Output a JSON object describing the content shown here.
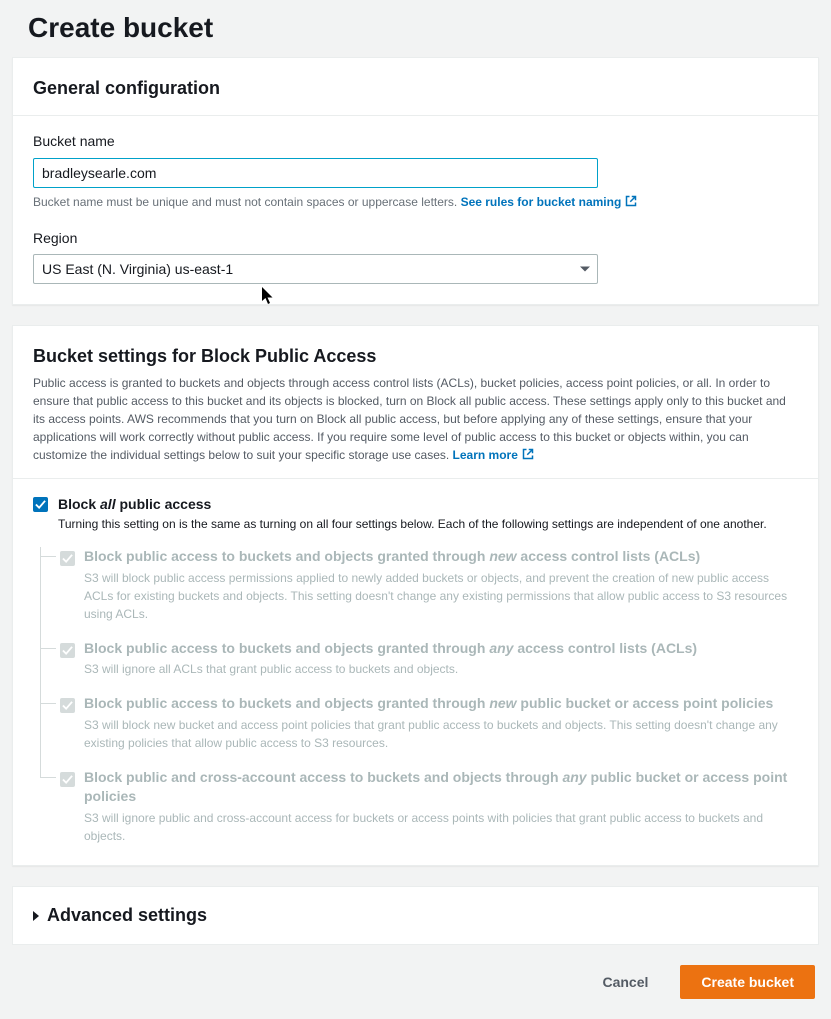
{
  "pageTitle": "Create bucket",
  "general": {
    "heading": "General configuration",
    "bucketName": {
      "label": "Bucket name",
      "value": "bradleysearle.com",
      "hint": "Bucket name must be unique and must not contain spaces or uppercase letters. ",
      "hintLink": "See rules for bucket naming"
    },
    "region": {
      "label": "Region",
      "selected": "US East (N. Virginia) us-east-1"
    }
  },
  "bpa": {
    "heading": "Bucket settings for Block Public Access",
    "desc": "Public access is granted to buckets and objects through access control lists (ACLs), bucket policies, access point policies, or all. In order to ensure that public access to this bucket and its objects is blocked, turn on Block all public access. These settings apply only to this bucket and its access points. AWS recommends that you turn on Block all public access, but before applying any of these settings, ensure that your applications will work correctly without public access. If you require some level of public access to this bucket or objects within, you can customize the individual settings below to suit your specific storage use cases. ",
    "learnMore": "Learn more",
    "root": {
      "labelPre": "Block ",
      "labelEm": "all",
      "labelPost": " public access",
      "desc": "Turning this setting on is the same as turning on all four settings below. Each of the following settings are independent of one another."
    },
    "items": [
      {
        "labelPre": "Block public access to buckets and objects granted through ",
        "labelEm": "new",
        "labelPost": " access control lists (ACLs)",
        "desc": "S3 will block public access permissions applied to newly added buckets or objects, and prevent the creation of new public access ACLs for existing buckets and objects. This setting doesn't change any existing permissions that allow public access to S3 resources using ACLs."
      },
      {
        "labelPre": "Block public access to buckets and objects granted through ",
        "labelEm": "any",
        "labelPost": " access control lists (ACLs)",
        "desc": "S3 will ignore all ACLs that grant public access to buckets and objects."
      },
      {
        "labelPre": "Block public access to buckets and objects granted through ",
        "labelEm": "new",
        "labelPost": " public bucket or access point policies",
        "desc": "S3 will block new bucket and access point policies that grant public access to buckets and objects. This setting doesn't change any existing policies that allow public access to S3 resources."
      },
      {
        "labelPre": "Block public and cross-account access to buckets and objects through ",
        "labelEm": "any",
        "labelPost": " public bucket or access point policies",
        "desc": "S3 will ignore public and cross-account access for buckets or access points with policies that grant public access to buckets and objects."
      }
    ]
  },
  "advanced": {
    "heading": "Advanced settings"
  },
  "footer": {
    "cancel": "Cancel",
    "submit": "Create bucket"
  }
}
